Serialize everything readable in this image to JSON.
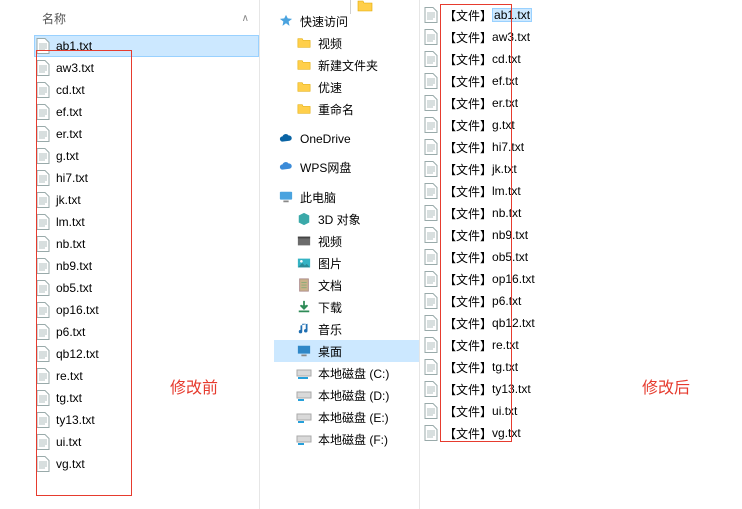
{
  "left": {
    "header_label": "名称",
    "files": [
      "ab1.txt",
      "aw3.txt",
      "cd.txt",
      "ef.txt",
      "er.txt",
      "g.txt",
      "hi7.txt",
      "jk.txt",
      "lm.txt",
      "nb.txt",
      "nb9.txt",
      "ob5.txt",
      "op16.txt",
      "p6.txt",
      "qb12.txt",
      "re.txt",
      "tg.txt",
      "ty13.txt",
      "ui.txt",
      "vg.txt"
    ],
    "annotation": "修改前"
  },
  "tree": {
    "quick_access": "快速访问",
    "quick_items": [
      {
        "label": "视频",
        "icon": "folder"
      },
      {
        "label": "新建文件夹",
        "icon": "folder"
      },
      {
        "label": "优速",
        "icon": "folder"
      },
      {
        "label": "重命名",
        "icon": "folder"
      }
    ],
    "onedrive": "OneDrive",
    "wps": "WPS网盘",
    "this_pc": "此电脑",
    "pc_items": [
      {
        "label": "3D 对象",
        "icon": "3d"
      },
      {
        "label": "视频",
        "icon": "video"
      },
      {
        "label": "图片",
        "icon": "pictures"
      },
      {
        "label": "文档",
        "icon": "docs"
      },
      {
        "label": "下载",
        "icon": "downloads"
      },
      {
        "label": "音乐",
        "icon": "music"
      },
      {
        "label": "桌面",
        "icon": "desktop",
        "selected": true
      },
      {
        "label": "本地磁盘 (C:)",
        "icon": "drive-c"
      },
      {
        "label": "本地磁盘 (D:)",
        "icon": "drive"
      },
      {
        "label": "本地磁盘 (E:)",
        "icon": "drive"
      },
      {
        "label": "本地磁盘 (F:)",
        "icon": "drive"
      }
    ]
  },
  "right": {
    "prefix": "【文件】",
    "files": [
      "ab1.txt",
      "aw3.txt",
      "cd.txt",
      "ef.txt",
      "er.txt",
      "g.txt",
      "hi7.txt",
      "jk.txt",
      "lm.txt",
      "nb.txt",
      "nb9.txt",
      "ob5.txt",
      "op16.txt",
      "p6.txt",
      "qb12.txt",
      "re.txt",
      "tg.txt",
      "ty13.txt",
      "ui.txt",
      "vg.txt"
    ],
    "annotation": "修改后"
  }
}
